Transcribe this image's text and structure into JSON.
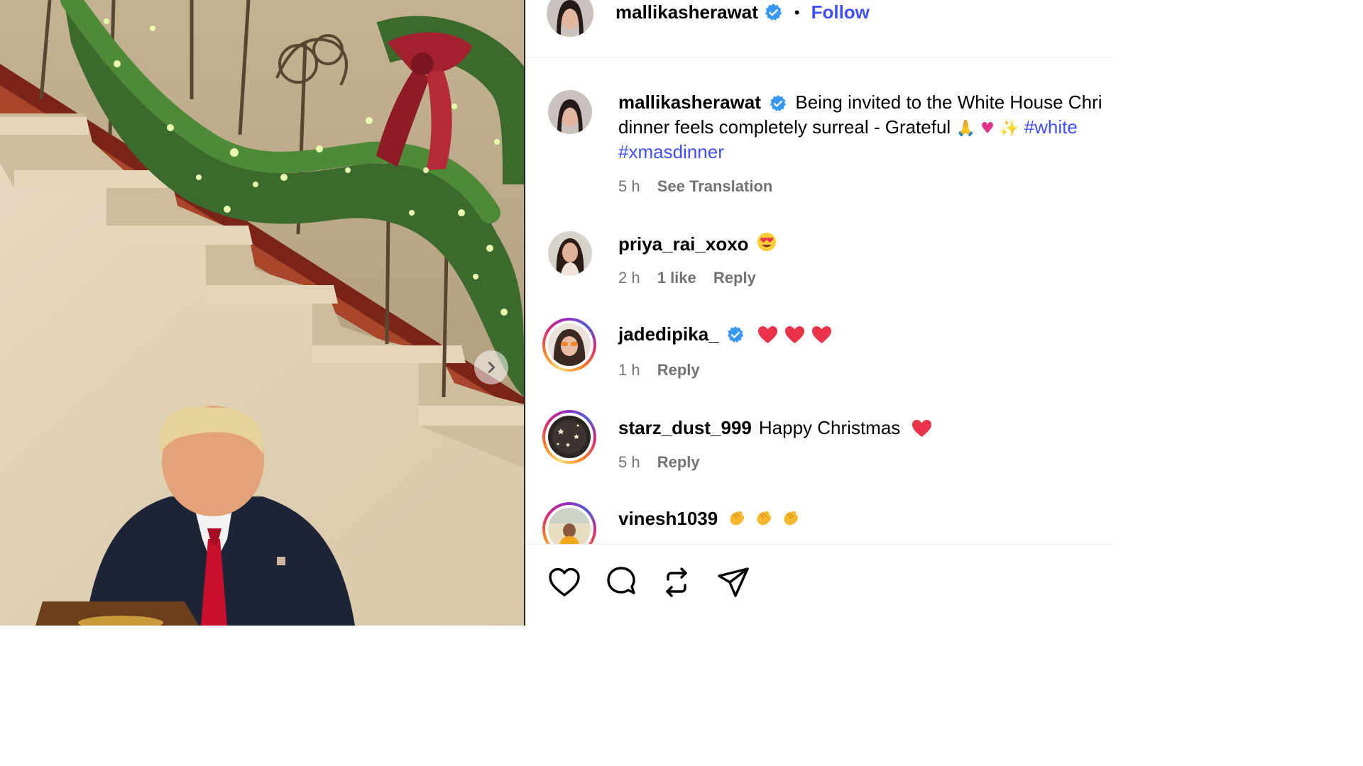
{
  "post": {
    "author": "mallikasherawat",
    "follow_label": "Follow",
    "separator": "•"
  },
  "caption": {
    "username": "mallikasherawat",
    "text_line1": "Being invited to the White House Chri",
    "text_line2": "dinner feels completely surreal - Grateful",
    "hashtag1": "#white",
    "hashtag2": "#xmasdinner",
    "time": "5 h",
    "see_translation": "See Translation"
  },
  "comments": [
    {
      "username": "priya_rai_xoxo",
      "text": "",
      "time": "2 h",
      "likes": "1 like",
      "reply": "Reply",
      "verified": false,
      "ring": false
    },
    {
      "username": "jadedipika_",
      "text": "",
      "time": "1 h",
      "likes": "",
      "reply": "Reply",
      "verified": true,
      "ring": true
    },
    {
      "username": "starz_dust_999",
      "text": "Happy Christmas",
      "time": "5 h",
      "likes": "",
      "reply": "Reply",
      "verified": false,
      "ring": true
    },
    {
      "username": "vinesh1039",
      "text": "",
      "time": "",
      "likes": "",
      "reply": "",
      "verified": false,
      "ring": true
    }
  ],
  "actions": [
    "like-icon",
    "comment-icon",
    "repost-icon",
    "share-icon"
  ],
  "colors": {
    "link_blue": "#4150f7",
    "verified_blue": "#3897f0",
    "meta_gray": "#737373",
    "heart_red": "#e8334a"
  }
}
